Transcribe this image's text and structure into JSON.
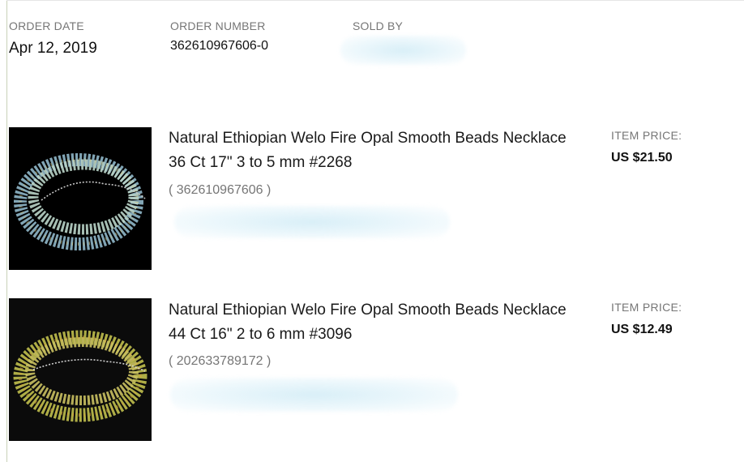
{
  "order": {
    "date_label": "ORDER DATE",
    "date_value": "Apr 12, 2019",
    "number_label": "ORDER NUMBER",
    "number_value": "362610967606-0",
    "sold_by_label": "SOLD BY"
  },
  "items": [
    {
      "title_line1": "Natural Ethiopian Welo Fire Opal Smooth Beads Necklace",
      "title_line2": "36 Ct 17\" 3 to 5 mm #2268",
      "item_id": "( 362610967606 )",
      "price_label": "ITEM PRICE:",
      "price": "US $21.50",
      "image_icon": "opal-necklace-image"
    },
    {
      "title_line1": "Natural Ethiopian Welo Fire Opal Smooth Beads Necklace",
      "title_line2": "44 Ct 16\" 2 to 6 mm #3096",
      "item_id": "( 202633789172 )",
      "price_label": "ITEM PRICE:",
      "price": "US $12.49",
      "image_icon": "opal-necklace-image"
    }
  ],
  "colors": {
    "label_gray": "#767676",
    "text_dark": "#111111",
    "redaction_blue": "#d2ecf6",
    "thumb_background": "#000000"
  }
}
